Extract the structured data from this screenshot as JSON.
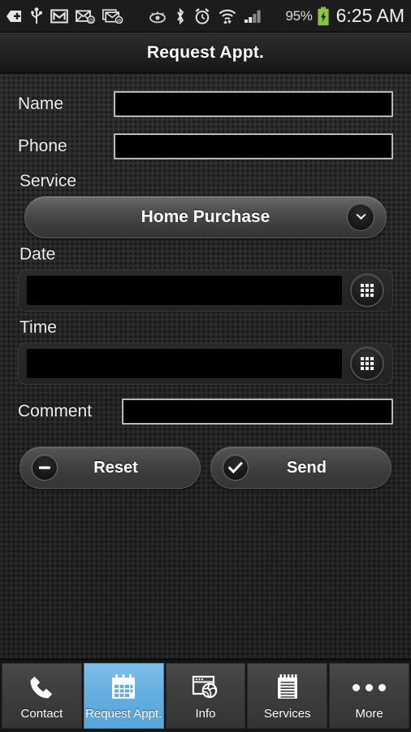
{
  "statusbar": {
    "icons": [
      {
        "name": "back-arrow-plus-icon",
        "glyph": "back-plus"
      },
      {
        "name": "usb-icon",
        "glyph": "usb"
      },
      {
        "name": "gmail-icon",
        "glyph": "gmail"
      },
      {
        "name": "email-icon",
        "glyph": "email"
      },
      {
        "name": "email-stack-icon",
        "glyph": "email-stack"
      },
      {
        "name": "smart-stay-eye-icon",
        "glyph": "eye"
      },
      {
        "name": "bluetooth-icon",
        "glyph": "bluetooth"
      },
      {
        "name": "alarm-clock-icon",
        "glyph": "alarm"
      },
      {
        "name": "wifi-icon",
        "glyph": "wifi"
      },
      {
        "name": "cellular-signal-icon",
        "glyph": "signal"
      }
    ],
    "battery_percent": "95%",
    "battery_icon": "battery-charging-icon",
    "clock": "6:25 AM",
    "battery_color": "#8bc53f"
  },
  "header": {
    "title": "Request Appt."
  },
  "form": {
    "name": {
      "label": "Name",
      "value": "",
      "placeholder": ""
    },
    "phone": {
      "label": "Phone",
      "value": "",
      "placeholder": ""
    },
    "service": {
      "label": "Service",
      "selected": "Home Purchase",
      "chevron_icon": "chevron-down-icon"
    },
    "date": {
      "label": "Date",
      "value": "",
      "placeholder": "",
      "picker_icon": "grid-picker-icon"
    },
    "time": {
      "label": "Time",
      "value": "",
      "placeholder": "",
      "picker_icon": "grid-picker-icon"
    },
    "comment": {
      "label": "Comment",
      "value": "",
      "placeholder": ""
    },
    "reset_button": {
      "label": "Reset",
      "icon": "minus-circle-icon"
    },
    "send_button": {
      "label": "Send",
      "icon": "check-circle-icon"
    }
  },
  "tabbar": {
    "active_index": 1,
    "active_color": "#64afe0",
    "items": [
      {
        "label": "Contact",
        "icon": "phone-icon"
      },
      {
        "label": "Request Appt.",
        "icon": "calendar-icon"
      },
      {
        "label": "Info",
        "icon": "browser-globe-icon"
      },
      {
        "label": "Services",
        "icon": "notepad-icon"
      },
      {
        "label": "More",
        "icon": "ellipsis-icon"
      }
    ]
  }
}
